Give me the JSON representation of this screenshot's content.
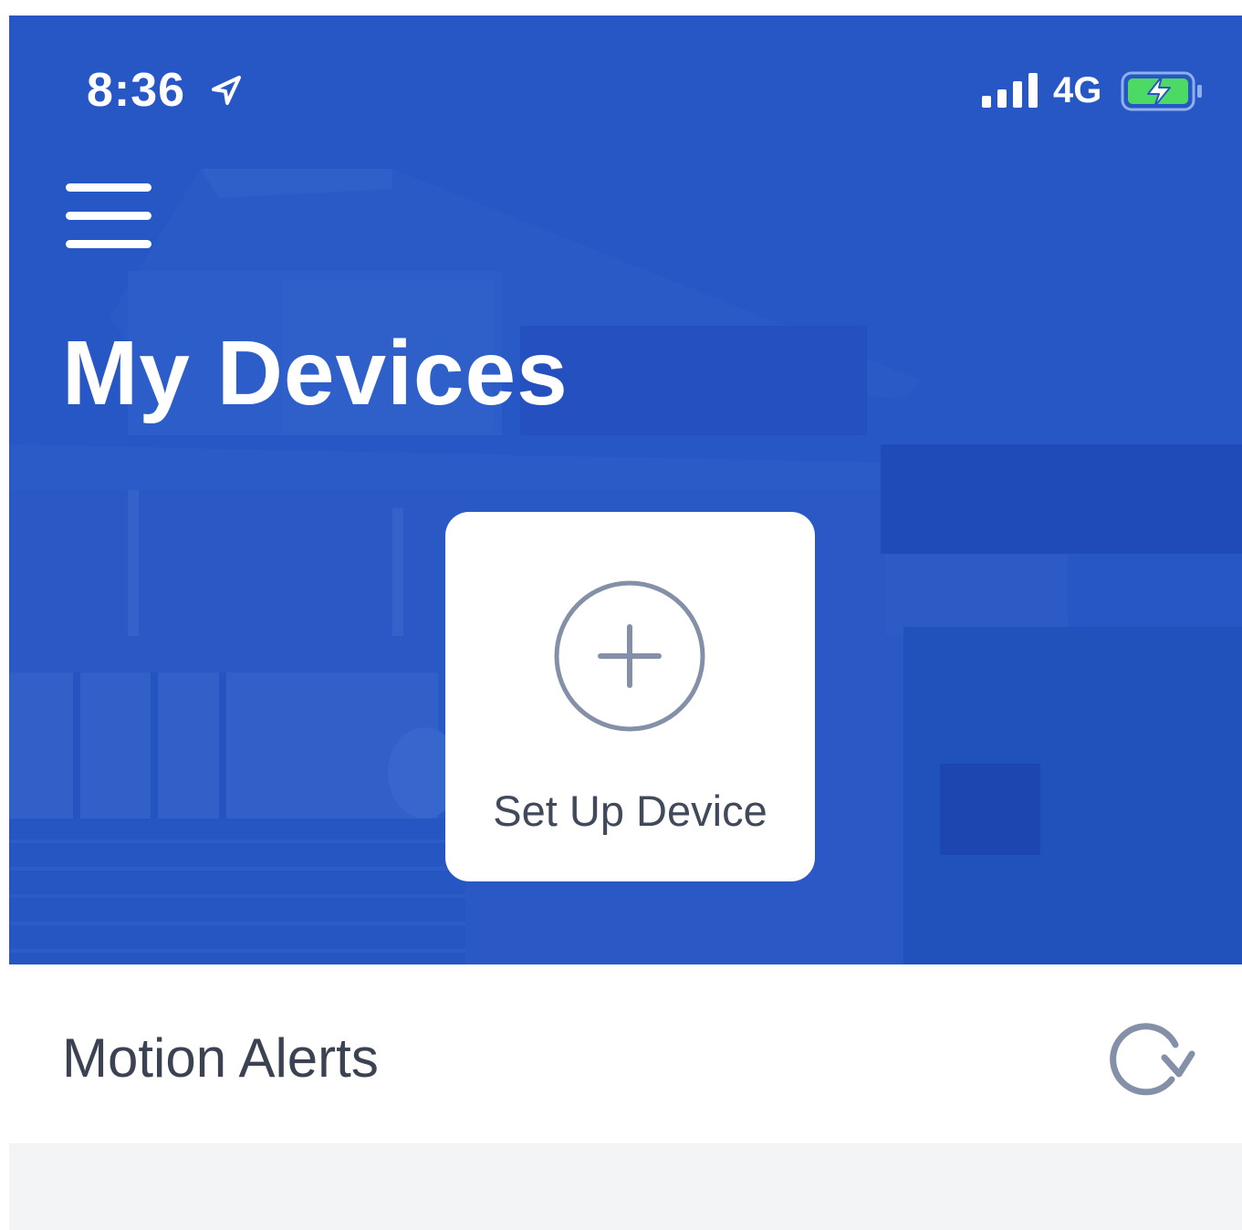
{
  "status_bar": {
    "time": "8:36",
    "network": "4G",
    "icons": [
      "location-arrow-icon",
      "cellular-signal-icon",
      "battery-charging-icon"
    ]
  },
  "header": {
    "menu_icon": "hamburger-menu-icon",
    "title": "My Devices"
  },
  "setup_card": {
    "icon": "plus-circle-icon",
    "label": "Set Up Device"
  },
  "alerts": {
    "title": "Motion Alerts",
    "refresh_icon": "refresh-icon"
  },
  "colors": {
    "hero_blue": "#2657c4",
    "card_text": "#414a5a",
    "icon_gray": "#8390a8",
    "battery_green": "#4cd964",
    "list_background": "#f3f4f6"
  }
}
